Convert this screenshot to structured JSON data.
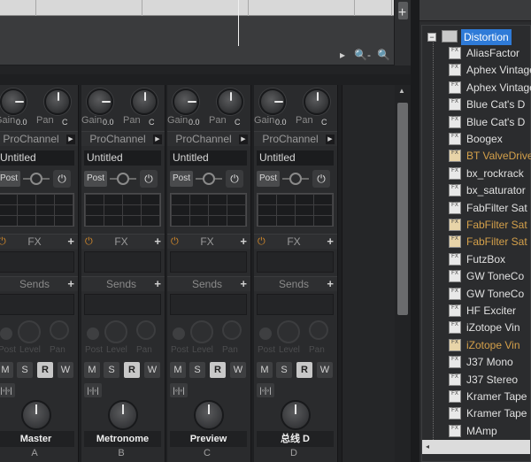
{
  "timeline": {
    "add_label": "+",
    "zoom_out_icon": "zoom-out-icon",
    "zoom_in_icon": "zoom-in-icon",
    "scroll_right_glyph": "▸",
    "zoom_out_glyph": "🔍-",
    "zoom_in_glyph": "🔍+"
  },
  "strip_common": {
    "gain_label": "Gain",
    "gain_value": "0.0",
    "pan_label": "Pan",
    "pan_value": "C",
    "prochannel_label": "ProChannel",
    "prochannel_arrow": "▶",
    "preset_name": "Untitled",
    "post_label": "Post",
    "power_glyph": "⏻",
    "fx_label": "FX",
    "plus_label": "+",
    "sends_label": "Sends",
    "send_post_label": "Post",
    "send_level_label": "Level",
    "send_pan_label": "Pan",
    "mute_label": "M",
    "solo_label": "S",
    "read_label": "R",
    "write_label": "W",
    "io_glyph": "|◦|◦|"
  },
  "strips": [
    {
      "name": "Master",
      "letter": "A"
    },
    {
      "name": "Metronome",
      "letter": "B"
    },
    {
      "name": "Preview",
      "letter": "C"
    },
    {
      "name": "总线 D",
      "letter": "D"
    }
  ],
  "browser": {
    "root_label": "Distortion",
    "expander_glyph": "−",
    "fx_icon_text": "FX",
    "scroll_left_glyph": "◂",
    "items": [
      {
        "label": "AliasFactor",
        "warm": false
      },
      {
        "label": "Aphex Vintage",
        "warm": false
      },
      {
        "label": "Aphex Vintage",
        "warm": false
      },
      {
        "label": "Blue Cat's D",
        "warm": false
      },
      {
        "label": "Blue Cat's D",
        "warm": false
      },
      {
        "label": "Boogex",
        "warm": false
      },
      {
        "label": "BT ValveDrive",
        "warm": true
      },
      {
        "label": "bx_rockrack",
        "warm": false
      },
      {
        "label": "bx_saturator",
        "warm": false
      },
      {
        "label": "FabFilter Sat",
        "warm": false
      },
      {
        "label": "FabFilter Sat",
        "warm": true
      },
      {
        "label": "FabFilter Sat",
        "warm": true
      },
      {
        "label": "FutzBox",
        "warm": false
      },
      {
        "label": "GW ToneCo",
        "warm": false
      },
      {
        "label": "GW ToneCo",
        "warm": false
      },
      {
        "label": "HF Exciter",
        "warm": false
      },
      {
        "label": "iZotope Vin",
        "warm": false
      },
      {
        "label": "iZotope Vin",
        "warm": true
      },
      {
        "label": "J37 Mono",
        "warm": false
      },
      {
        "label": "J37 Stereo",
        "warm": false
      },
      {
        "label": "Kramer Tape",
        "warm": false
      },
      {
        "label": "Kramer Tape",
        "warm": false
      },
      {
        "label": "MAmp",
        "warm": false
      }
    ]
  }
}
